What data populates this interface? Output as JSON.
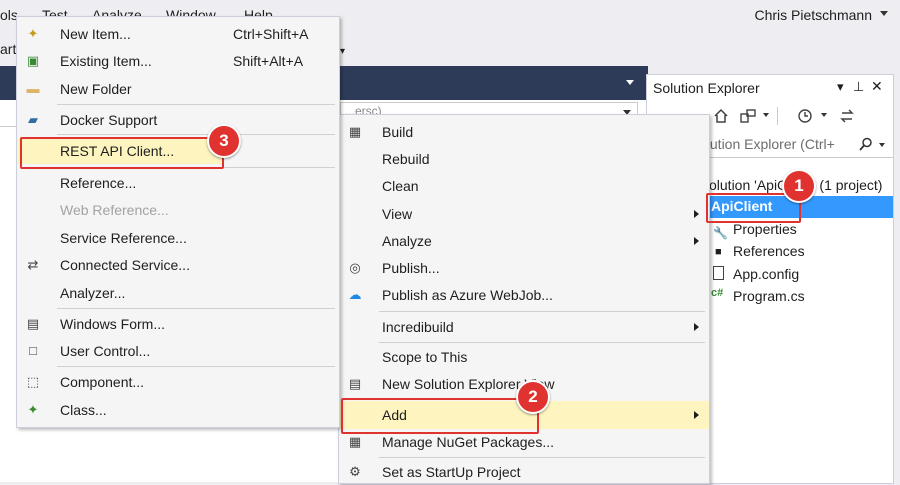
{
  "menubar": {
    "items": [
      "ols",
      "Test",
      "Analyze",
      "Window",
      "Help"
    ],
    "user": "Chris Pietschmann"
  },
  "toolbar": {
    "left_text": "art",
    "caret": "▾"
  },
  "navbar": {
    "combo_text": "...ersc)"
  },
  "solution_explorer": {
    "title": "Solution Explorer",
    "title_buttons": [
      "▾",
      "⊥",
      "✕"
    ],
    "search_placeholder": "olution Explorer (Ctrl+",
    "tree": {
      "solution": "olution 'ApiClient' (1 project)",
      "project": "ApiClient",
      "items": [
        "Properties",
        "References",
        "App.config",
        "Program.cs"
      ]
    }
  },
  "add_submenu": {
    "items": [
      {
        "icon": "new-item-icon",
        "label": "New Item...",
        "shortcut": "Ctrl+Shift+A"
      },
      {
        "icon": "existing-item-icon",
        "label": "Existing Item...",
        "shortcut": "Shift+Alt+A"
      },
      {
        "icon": "new-folder-icon",
        "label": "New Folder",
        "shortcut": ""
      },
      {
        "icon": "docker-icon",
        "label": "Docker Support",
        "shortcut": ""
      },
      {
        "icon": "",
        "label": "REST API Client...",
        "shortcut": ""
      },
      {
        "icon": "",
        "label": "Reference...",
        "shortcut": ""
      },
      {
        "icon": "",
        "label": "Web Reference...",
        "shortcut": ""
      },
      {
        "icon": "",
        "label": "Service Reference...",
        "shortcut": ""
      },
      {
        "icon": "connected-service-icon",
        "label": "Connected Service...",
        "shortcut": ""
      },
      {
        "icon": "",
        "label": "Analyzer...",
        "shortcut": ""
      },
      {
        "icon": "windows-form-icon",
        "label": "Windows Form...",
        "shortcut": ""
      },
      {
        "icon": "user-control-icon",
        "label": "User Control...",
        "shortcut": ""
      },
      {
        "icon": "component-icon",
        "label": "Component...",
        "shortcut": ""
      },
      {
        "icon": "class-icon",
        "label": "Class...",
        "shortcut": ""
      }
    ]
  },
  "project_menu": {
    "items": [
      {
        "icon": "build-icon",
        "label": "Build"
      },
      {
        "icon": "",
        "label": "Rebuild"
      },
      {
        "icon": "",
        "label": "Clean"
      },
      {
        "icon": "",
        "label": "View"
      },
      {
        "icon": "",
        "label": "Analyze"
      },
      {
        "icon": "globe-icon",
        "label": "Publish..."
      },
      {
        "icon": "cloud-icon",
        "label": "Publish as Azure WebJob..."
      },
      {
        "icon": "",
        "label": "Incredibuild"
      },
      {
        "icon": "",
        "label": "Scope to This"
      },
      {
        "icon": "new-explorer-view-icon",
        "label": "New Solution Explorer View"
      },
      {
        "icon": "",
        "label": "Add"
      },
      {
        "icon": "nuget-icon",
        "label": "Manage NuGet Packages..."
      },
      {
        "icon": "gear-icon",
        "label": "Set as StartUp Project"
      }
    ]
  },
  "callouts": [
    "1",
    "2",
    "3"
  ],
  "colors": {
    "highlight": "#fdf4bf",
    "selection": "#3399ff",
    "callout": "#e0332f",
    "tab_well": "#2d3b59"
  }
}
